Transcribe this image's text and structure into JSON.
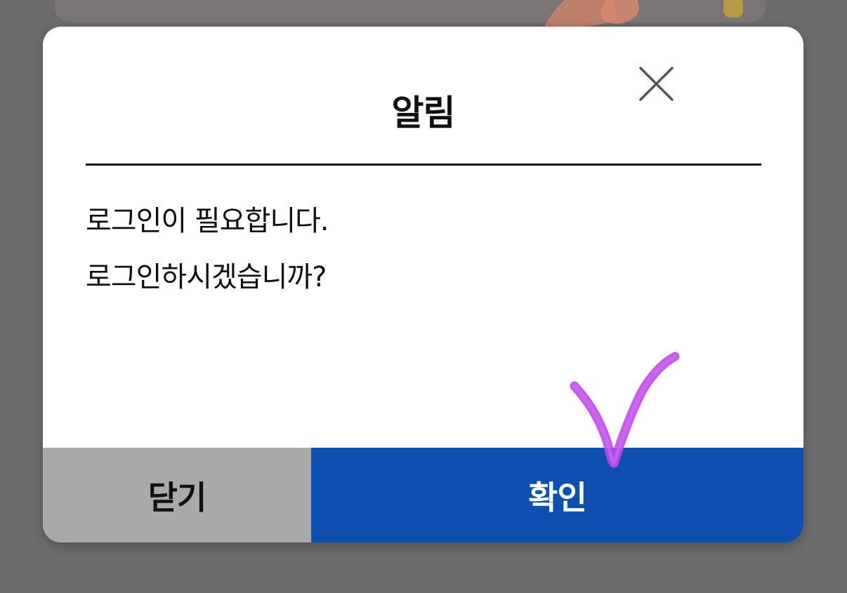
{
  "dialog": {
    "title": "알림",
    "message_lines": [
      "로그인이 필요합니다.",
      "로그인하시겠습니까?"
    ],
    "close_label": "닫기",
    "confirm_label": "확인"
  },
  "colors": {
    "overlay": "#6b6b6b",
    "confirm": "#0e4fb0",
    "close": "#a9a9a9",
    "annotation": "#c04be8"
  },
  "icons": {
    "close": "close-icon",
    "annotation": "checkmark-annotation-icon"
  }
}
